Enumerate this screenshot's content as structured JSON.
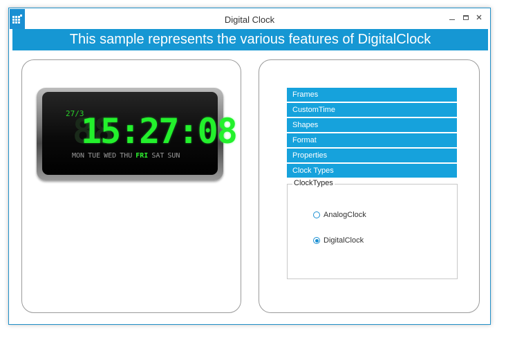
{
  "window": {
    "title": "Digital Clock",
    "minimize_icon": "minimize-icon",
    "maximize_icon": "maximize-icon",
    "close_icon": "close-icon",
    "accent_color": "#1697d3"
  },
  "banner": {
    "text": "This sample represents the various features of DigitalClock"
  },
  "clock": {
    "date": "27/3",
    "time": "15:27:08",
    "days": [
      "MON",
      "TUE",
      "WED",
      "THU",
      "FRI",
      "SAT",
      "SUN"
    ],
    "active_day": "FRI",
    "digit_color": "#23f12c"
  },
  "accordion": {
    "items": [
      {
        "label": "Frames"
      },
      {
        "label": "CustomTime"
      },
      {
        "label": "Shapes"
      },
      {
        "label": "Format"
      },
      {
        "label": "Properties"
      },
      {
        "label": "Clock Types"
      }
    ]
  },
  "clock_types": {
    "group_label": "ClockTypes",
    "options": [
      {
        "label": "AnalogClock",
        "selected": false
      },
      {
        "label": "DigitalClock",
        "selected": true
      }
    ]
  }
}
